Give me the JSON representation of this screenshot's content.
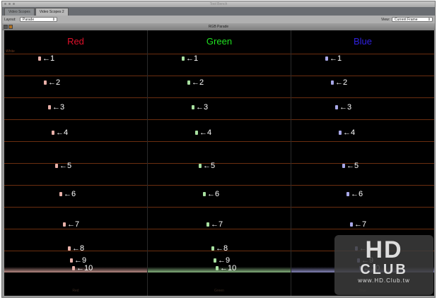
{
  "window": {
    "title": "Tool Bench"
  },
  "tabs": [
    {
      "label": "Video Scopes",
      "active": false
    },
    {
      "label": "Video Scopes 2",
      "active": true
    }
  ],
  "toolbar": {
    "layout_label": "Layout:",
    "layout_value": "Parade",
    "view_label": "View:",
    "view_value": "Current Frame"
  },
  "scope": {
    "title": "RGB Parade",
    "white_label": "White",
    "panels": [
      {
        "name": "Red",
        "color": "#e0102a",
        "trace": "#e8b0a8",
        "bottom_label": "Red"
      },
      {
        "name": "Green",
        "color": "#20e020",
        "trace": "#a8e0a0",
        "bottom_label": "Green"
      },
      {
        "name": "Blue",
        "color": "#3020e0",
        "trace": "#a8a8e8",
        "bottom_label": "Blue"
      }
    ],
    "markers": [
      "1",
      "2",
      "3",
      "4",
      "5",
      "6",
      "7",
      "8",
      "9",
      "10"
    ]
  },
  "watermark": {
    "big": "HD",
    "club": "CLUB",
    "url": "www.HD.Club.tw"
  }
}
